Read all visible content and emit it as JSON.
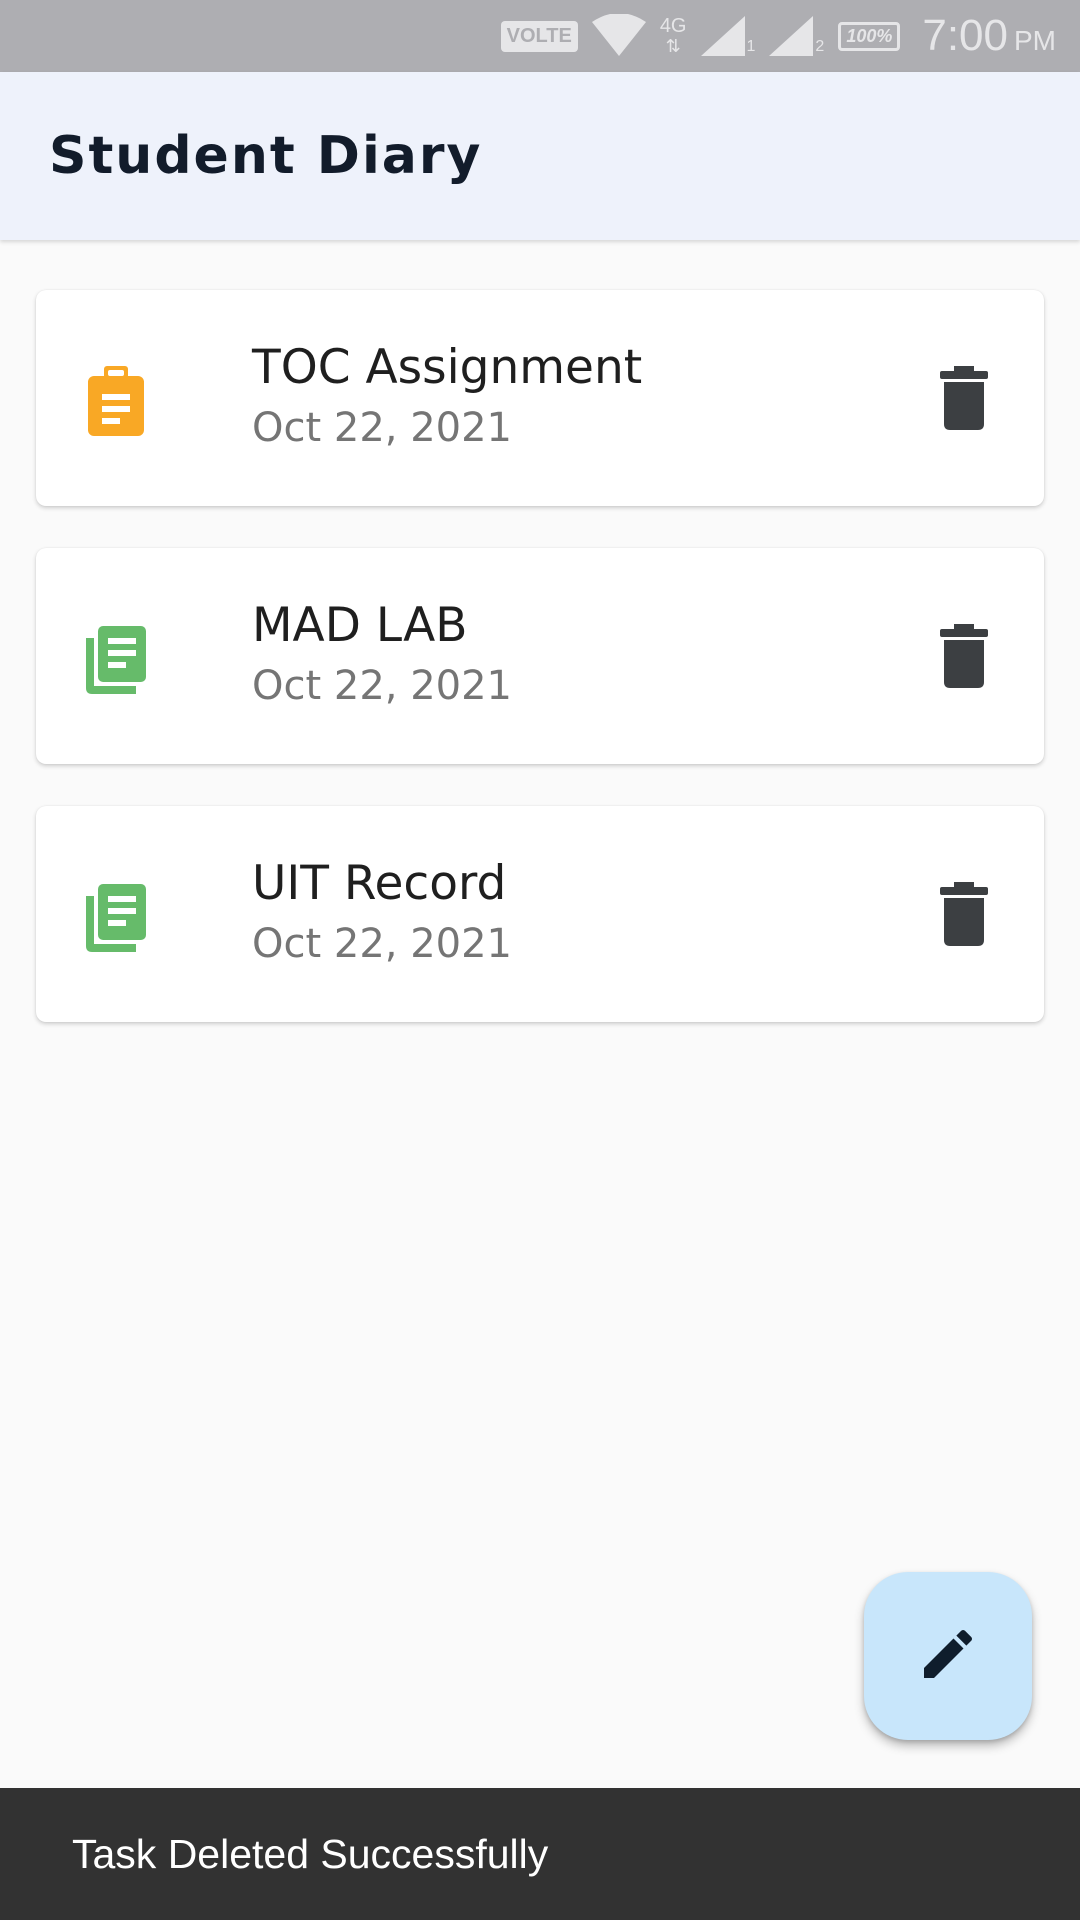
{
  "status_bar": {
    "volte_label": "VOLTE",
    "network_label": "4G",
    "sim1_label": "1",
    "sim2_label": "2",
    "battery_label": "100%",
    "time": "7:00",
    "ampm": "PM",
    "icons": [
      "wifi-icon",
      "signal-icon",
      "battery-icon"
    ]
  },
  "app_bar": {
    "title": "Student Diary"
  },
  "tasks": [
    {
      "title": "TOC Assignment",
      "date": "Oct 22, 2021",
      "icon": "assignment-icon",
      "icon_color": "#f9a825"
    },
    {
      "title": "MAD LAB",
      "date": "Oct 22, 2021",
      "icon": "library-books-icon",
      "icon_color": "#66bb6a"
    },
    {
      "title": "UIT Record",
      "date": "Oct 22, 2021",
      "icon": "library-books-icon",
      "icon_color": "#66bb6a"
    }
  ],
  "fab": {
    "icon": "edit-icon",
    "background": "#c8e6fb"
  },
  "snackbar": {
    "message": "Task Deleted Successfully"
  },
  "colors": {
    "app_bar_bg": "#eef2fb",
    "page_bg": "#fafafa",
    "delete_icon": "#3c3f42",
    "snackbar_bg": "#323232"
  }
}
